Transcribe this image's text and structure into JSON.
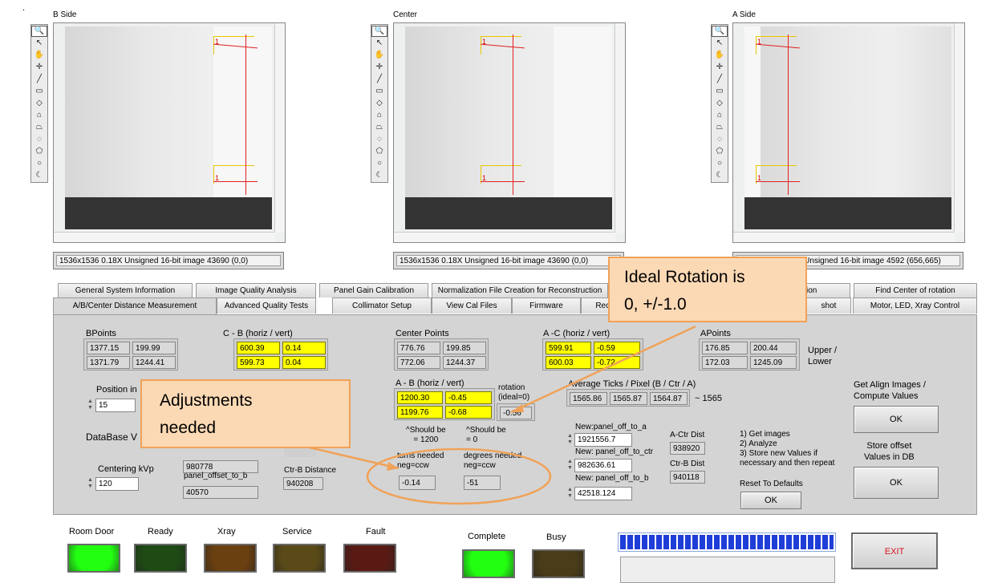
{
  "dot": ".",
  "panels": [
    {
      "title": "B Side",
      "status": "1536x1536 0.18X Unsigned 16-bit image 43690  (0,0)"
    },
    {
      "title": "Center",
      "status": "1536x1536 0.18X Unsigned 16-bit image 43690  (0,0)"
    },
    {
      "title": "A Side",
      "status": "1536x1536 0.18X Unsigned 16-bit image 4592  (656,665)"
    }
  ],
  "roi_label": "1",
  "tools": [
    "🔍",
    "↖",
    "✋",
    "✛",
    "╱",
    "▭",
    "◇",
    "⌂",
    "⏢",
    "◌",
    "⬠",
    "○",
    "☾"
  ],
  "tabs_back": [
    "General System Information",
    "Image Quality Analysis",
    "Panel Gain Calibration",
    "Normalization File Creation for Reconstruction",
    "",
    "Find Center of rotation"
  ],
  "tabs_front": [
    "A/B/Center Distance Measurement",
    "Advanced Quality Tests",
    "Collimator Setup",
    "View Cal Files",
    "Firmware",
    "Reco",
    "",
    "shot",
    "Motor, LED, Xray Control"
  ],
  "hidden_tab_fragment": "ion",
  "measure": {
    "bpoints_label": "BPoints",
    "bpoints": [
      [
        "1377.15",
        "199.99"
      ],
      [
        "1371.79",
        "1244.41"
      ]
    ],
    "cb_label": "C - B (horiz / vert)",
    "cb": [
      [
        "600.39",
        "0.14"
      ],
      [
        "599.73",
        "0.04"
      ]
    ],
    "center_label": "Center Points",
    "center": [
      [
        "776.76",
        "199.85"
      ],
      [
        "772.06",
        "1244.37"
      ]
    ],
    "ac_label": "A -C (horiz / vert)",
    "ac": [
      [
        "599.91",
        "-0.59"
      ],
      [
        "600.03",
        "-0.72"
      ]
    ],
    "apoints_label": "APoints",
    "apoints": [
      [
        "176.85",
        "200.44"
      ],
      [
        "172.03",
        "1245.09"
      ]
    ],
    "upper_lower": "Upper /\nLower",
    "ab_label": "A - B (horiz / vert)",
    "ab": [
      [
        "1200.30",
        "-0.45"
      ],
      [
        "1199.76",
        "-0.68"
      ]
    ],
    "rotation_label": "rotation\n(ideal=0)",
    "rotation": "-0.56",
    "avg_ticks_label": "Average Ticks / Pixel (B / Ctr / A)",
    "avg_ticks": [
      "1565.86",
      "1565.87",
      "1564.87"
    ],
    "approx": "~ 1565",
    "should_1200": "^Should be\n= 1200",
    "should_0": "^Should be\n= 0",
    "turns_label": "turns needed\nneg=ccw",
    "turns": "-0.14",
    "degrees_label": "degrees needed\nneg=ccw",
    "degrees": "-51",
    "position_label": "Position in",
    "position": "15",
    "database_label": "DataBase V",
    "db_value_1": "980778",
    "panel_offset_b_label": "panel_offset_to_b",
    "panel_offset_b": "40570",
    "ctr_b_distance_label": "Ctr-B Distance",
    "ctr_b_distance": "940208",
    "centering_label": "Centering kVp",
    "centering": "120",
    "new_a_label": "New:panel_off_to_a",
    "new_a": "1921556.7",
    "new_ctr_label": "New: panel_off_to_ctr",
    "new_ctr": "982636.61",
    "new_b_label": "New: panel_off_to_b",
    "new_b": "42518.124",
    "actr_dist_label": "A-Ctr Dist",
    "actr_dist": "938920",
    "ctrb_dist_label": "Ctr-B Dist",
    "ctrb_dist": "940118",
    "steps": "1) Get images\n2) Analyze\n3) Store new Values if\nnecessary and then repeat",
    "reset_label": "Reset To Defaults",
    "reset_btn": "OK",
    "get_align_label": "Get Align Images /\nCompute Values",
    "get_align_btn": "OK",
    "store_label": "Store offset\nValues in DB",
    "store_btn": "OK"
  },
  "leds": [
    {
      "label": "Room Door",
      "color": "#22ff11"
    },
    {
      "label": "Ready",
      "color": "#1e4a14"
    },
    {
      "label": "Xray",
      "color": "#6a4010"
    },
    {
      "label": "Service",
      "color": "#5a4a18"
    },
    {
      "label": "Fault",
      "color": "#5a1a14"
    },
    {
      "label": "Complete",
      "color": "#22ff11"
    },
    {
      "label": "Busy",
      "color": "#4a3c18"
    }
  ],
  "exit_label": "EXIT",
  "annotations": {
    "ideal_rotation": "Ideal Rotation is\n0, +/-1.0",
    "adjustments": "Adjustments\nneeded"
  },
  "colors": {
    "accent_orange": "#f0a258",
    "callout_fill": "#fbd9b5",
    "progress_blue": "#1f3ed8",
    "field_yellow": "#ffff00"
  }
}
